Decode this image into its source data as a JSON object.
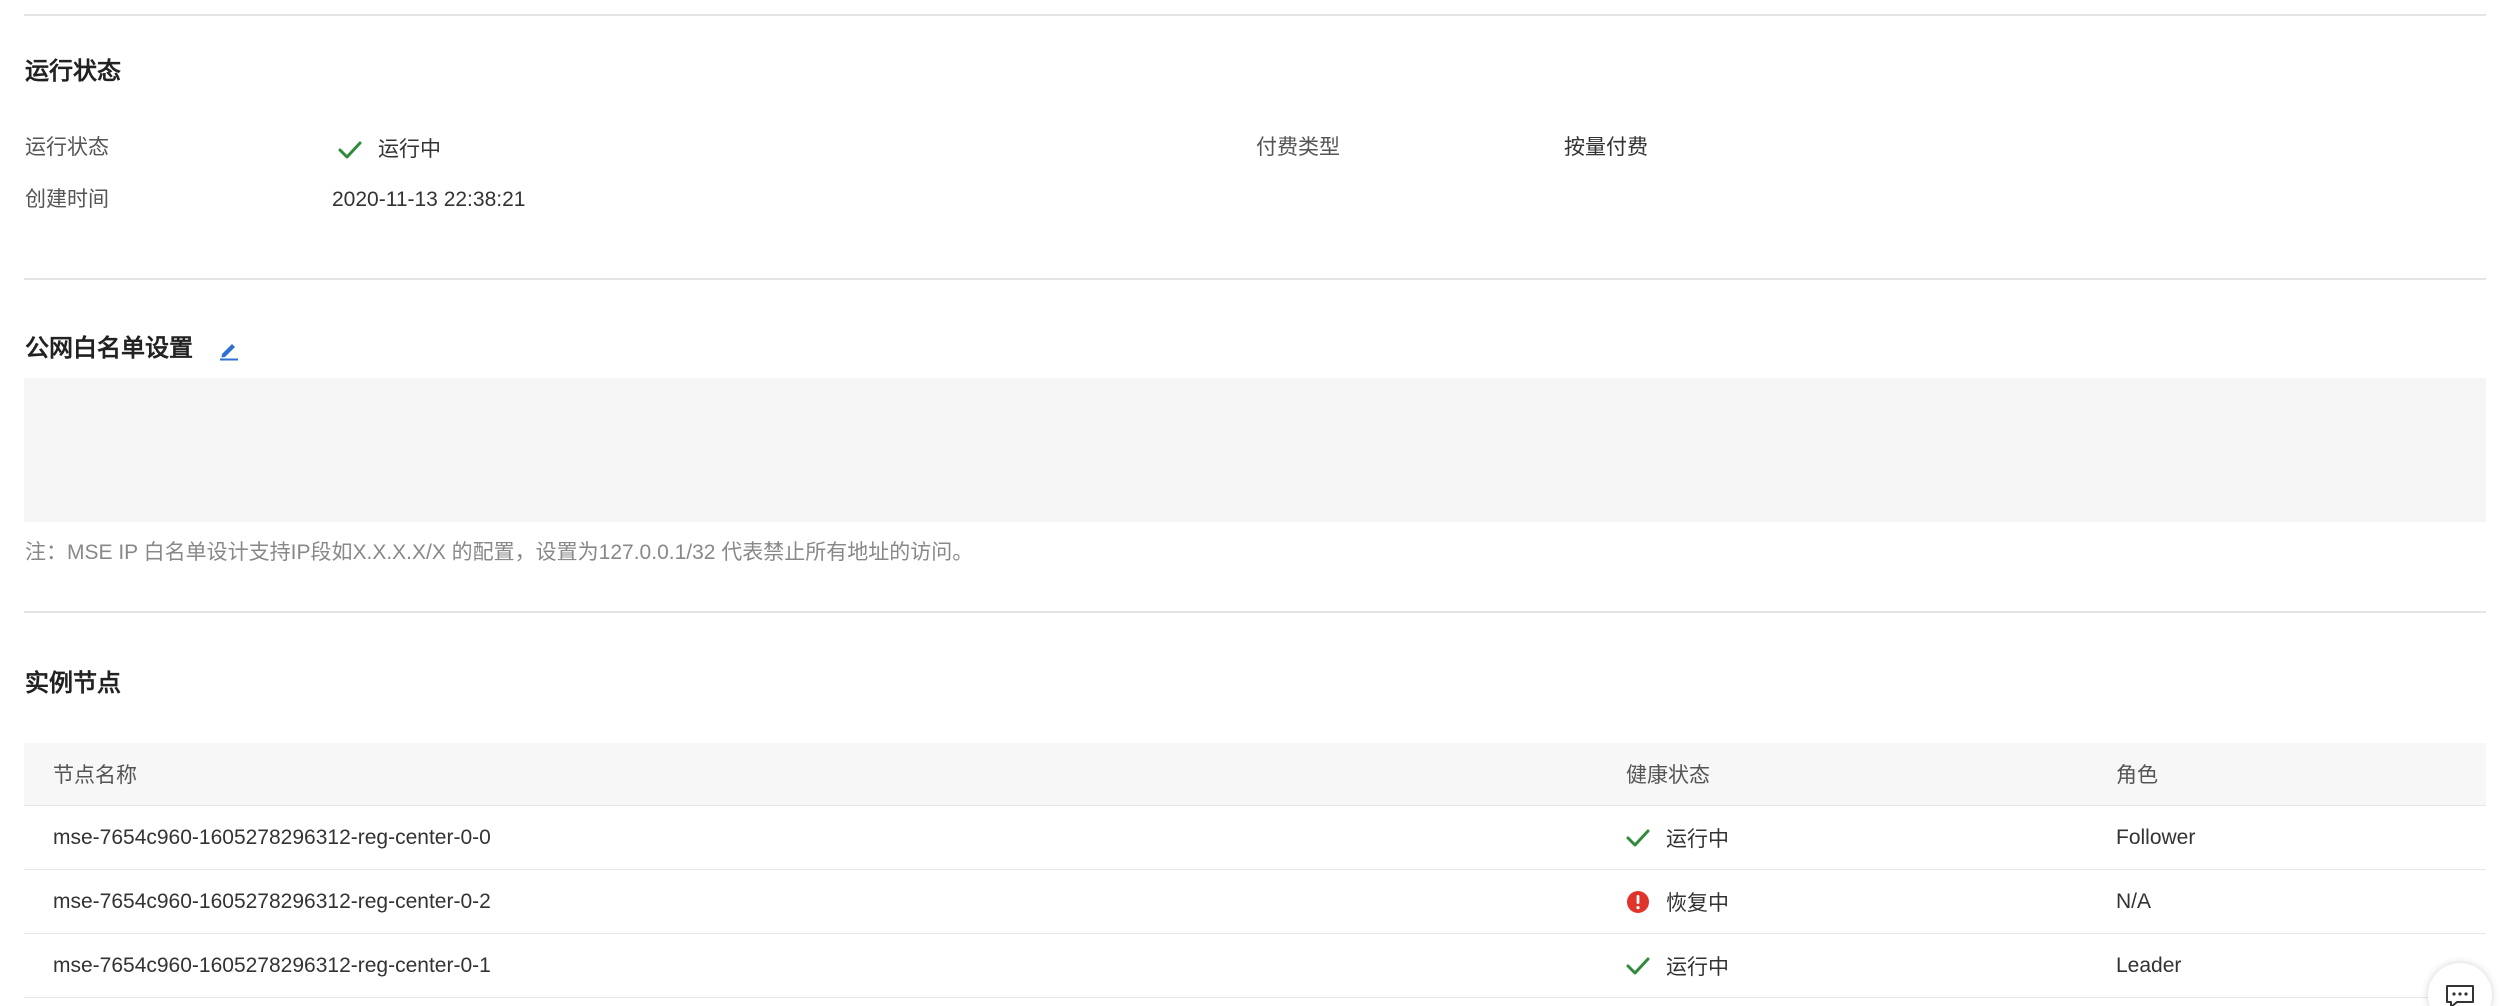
{
  "running_section": {
    "title": "运行状态",
    "fields": {
      "status_label": "运行状态",
      "status_value": "运行中",
      "billing_label": "付费类型",
      "billing_value": "按量付费",
      "created_label": "创建时间",
      "created_value": "2020-11-13 22:38:21"
    }
  },
  "whitelist_section": {
    "title": "公网白名单设置",
    "note": "注：MSE IP 白名单设计支持IP段如X.X.X.X/X 的配置，设置为127.0.0.1/32 代表禁止所有地址的访问。"
  },
  "nodes_section": {
    "title": "实例节点",
    "columns": [
      "节点名称",
      "健康状态",
      "角色"
    ],
    "rows": [
      {
        "name": "mse-7654c960-1605278296312-reg-center-0-0",
        "health": "运行中",
        "health_icon": "check-icon",
        "role": "Follower"
      },
      {
        "name": "mse-7654c960-1605278296312-reg-center-0-2",
        "health": "恢复中",
        "health_icon": "error-icon",
        "role": "N/A"
      },
      {
        "name": "mse-7654c960-1605278296312-reg-center-0-1",
        "health": "运行中",
        "health_icon": "check-icon",
        "role": "Leader"
      }
    ]
  },
  "colors": {
    "success": "#2e8b3c",
    "error": "#e0342b",
    "edit_link": "#2f6fd1"
  }
}
